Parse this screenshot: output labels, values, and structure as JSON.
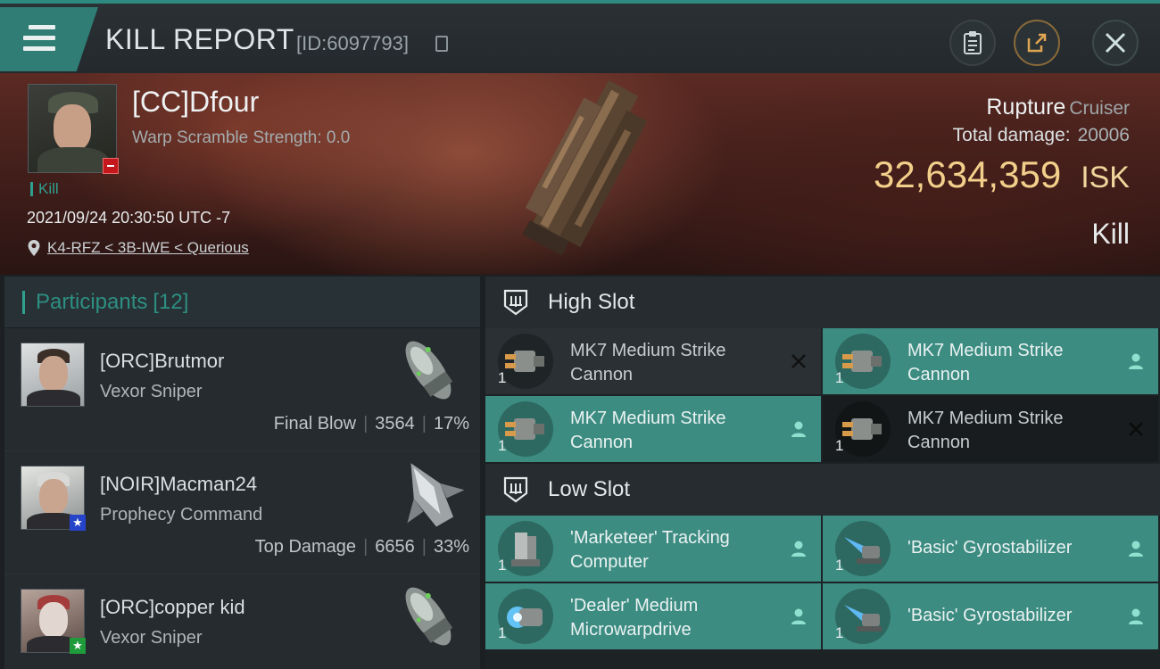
{
  "header": {
    "title": "KILL REPORT",
    "report_id": "[ID:6097793]"
  },
  "victim": {
    "name": "[CC]Dfour",
    "scramble": "Warp Scramble Strength: 0.0",
    "tag": "Kill",
    "datetime": "2021/09/24 20:30:50 UTC -7",
    "location": "K4-RFZ < 3B-IWE < Querious",
    "ship_name": "Rupture",
    "ship_class": "Cruiser",
    "total_damage_label": "Total damage:",
    "total_damage": "20006",
    "isk_value": "32,634,359",
    "isk_unit": "ISK",
    "result": "Kill"
  },
  "participants": {
    "label": "Participants",
    "count": "[12]",
    "rows": [
      {
        "name": "[ORC]Brutmor",
        "ship": "Vexor Sniper",
        "role": "Final Blow",
        "damage": "3564",
        "percent": "17%"
      },
      {
        "name": "[NOIR]Macman24",
        "ship": "Prophecy Command",
        "role": "Top Damage",
        "damage": "6656",
        "percent": "33%"
      },
      {
        "name": "[ORC]copper kid",
        "ship": "Vexor Sniper",
        "role": "",
        "damage": "",
        "percent": ""
      }
    ]
  },
  "fittings": {
    "high_slot_label": "High Slot",
    "low_slot_label": "Low Slot",
    "high": [
      {
        "name": "MK7 Medium Strike Cannon",
        "qty": "1"
      },
      {
        "name": "MK7 Medium Strike Cannon",
        "qty": "1"
      },
      {
        "name": "MK7 Medium Strike Cannon",
        "qty": "1"
      },
      {
        "name": "MK7 Medium Strike Cannon",
        "qty": "1"
      }
    ],
    "low": [
      {
        "name": "'Marketeer' Tracking Computer",
        "qty": "1"
      },
      {
        "name": "'Basic' Gyrostabilizer",
        "qty": "1"
      },
      {
        "name": "'Dealer' Medium Microwarpdrive",
        "qty": "1"
      },
      {
        "name": "'Basic' Gyrostabilizer",
        "qty": "1"
      }
    ]
  },
  "colors": {
    "accent": "#2fa08f",
    "isk": "#f2cf8a",
    "teal_cell": "#3c8c82",
    "destroyed_badge": "#c5181c"
  }
}
